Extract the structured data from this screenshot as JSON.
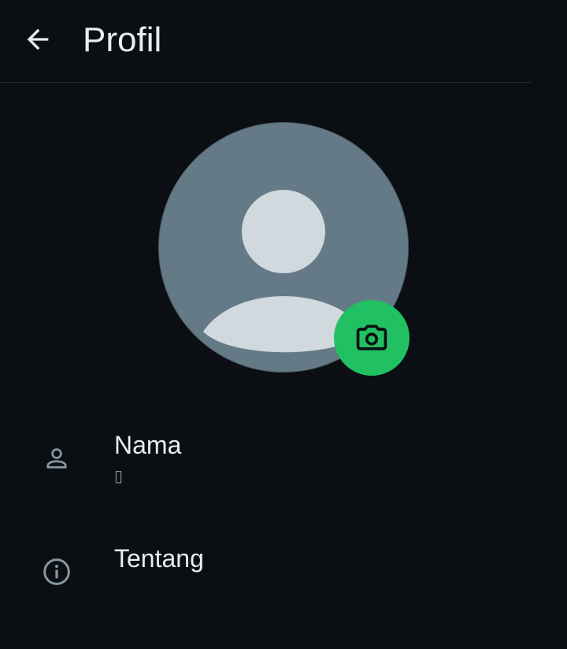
{
  "header": {
    "title": "Profil",
    "back_icon": "arrow-left-icon"
  },
  "avatar": {
    "placeholder_icon": "default-user-silhouette",
    "camera_icon": "camera-icon",
    "camera_color": "#21c063"
  },
  "rows": [
    {
      "icon": "person-icon",
      "label": "Nama",
      "value": "▯"
    },
    {
      "icon": "info-icon",
      "label": "Tentang"
    }
  ]
}
